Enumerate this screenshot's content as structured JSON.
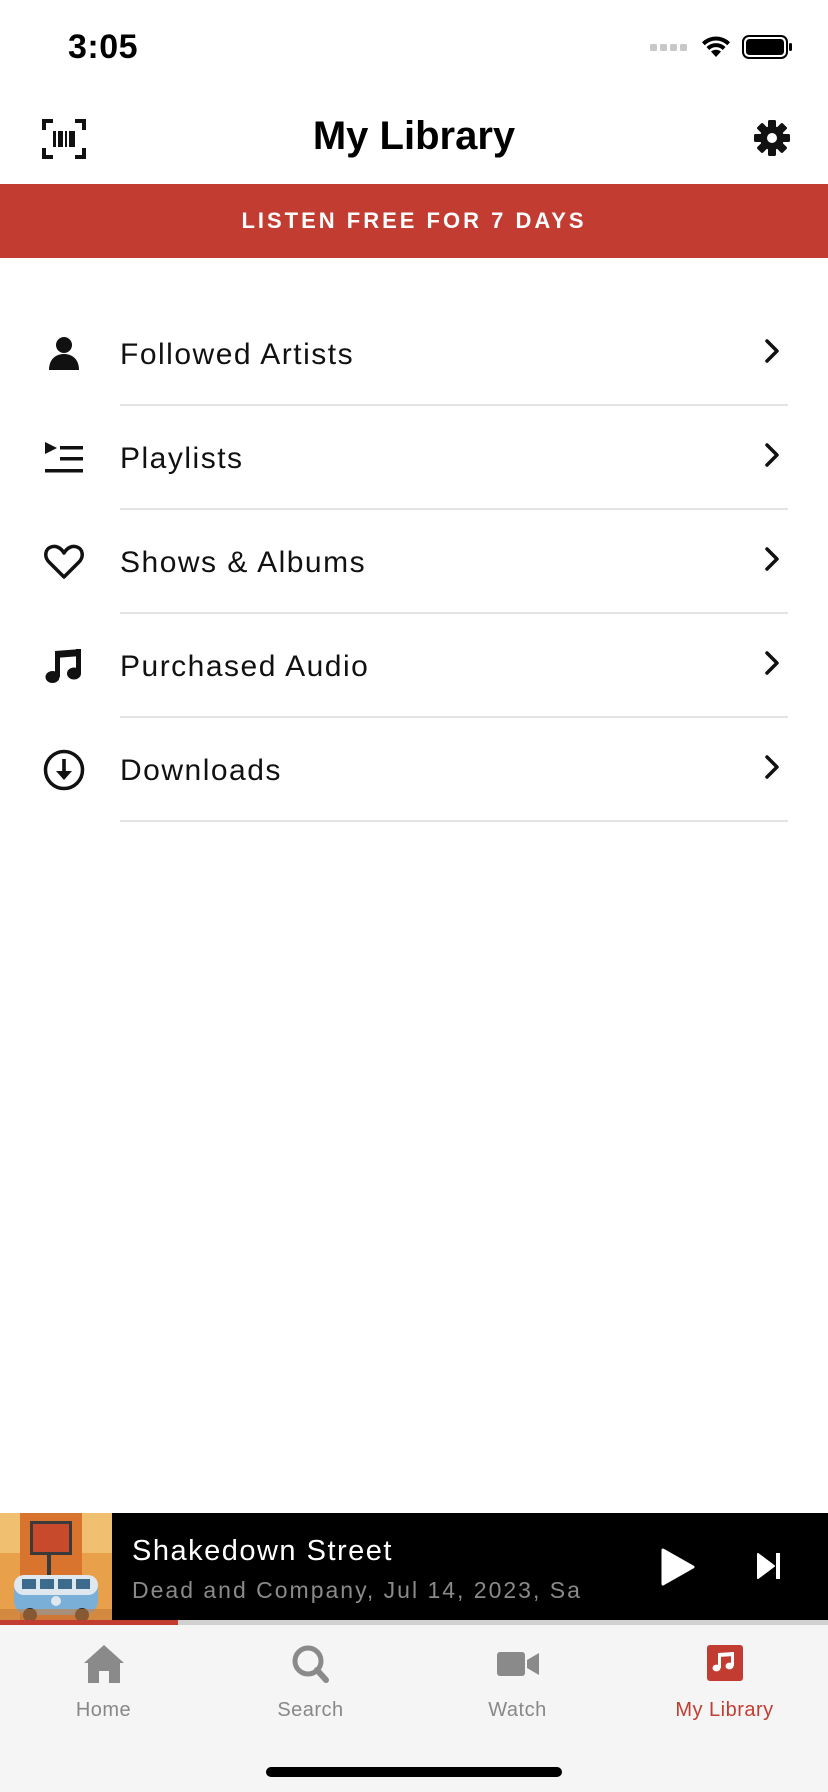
{
  "status_bar": {
    "time": "3:05",
    "icons": [
      "cellular-signal-icon",
      "wifi-icon",
      "battery-icon"
    ]
  },
  "nav": {
    "title": "My Library",
    "left_icon": "barcode-scan-icon",
    "right_icon": "gear-icon"
  },
  "promo": {
    "label": "LISTEN FREE FOR 7 DAYS",
    "background_color": "#c33c32"
  },
  "menu": {
    "items": [
      {
        "label": "Followed Artists",
        "icon": "person-icon"
      },
      {
        "label": "Playlists",
        "icon": "playlist-icon"
      },
      {
        "label": "Shows & Albums",
        "icon": "heart-icon"
      },
      {
        "label": "Purchased Audio",
        "icon": "music-note-icon"
      },
      {
        "label": "Downloads",
        "icon": "download-icon"
      }
    ]
  },
  "player": {
    "track_title": "Shakedown Street",
    "subtitle": "Dead and Company, Jul 14, 2023, Sa",
    "progress_fraction": 0.215,
    "play_icon": "play-icon",
    "next_icon": "skip-next-icon"
  },
  "tabs": [
    {
      "label": "Home",
      "icon": "home-icon",
      "active": false
    },
    {
      "label": "Search",
      "icon": "search-icon",
      "active": false
    },
    {
      "label": "Watch",
      "icon": "video-camera-icon",
      "active": false
    },
    {
      "label": "My Library",
      "icon": "music-library-icon",
      "active": true
    }
  ],
  "colors": {
    "accent": "#c33c32",
    "inactive_tab": "#888888",
    "divider": "#e4e4e4"
  }
}
